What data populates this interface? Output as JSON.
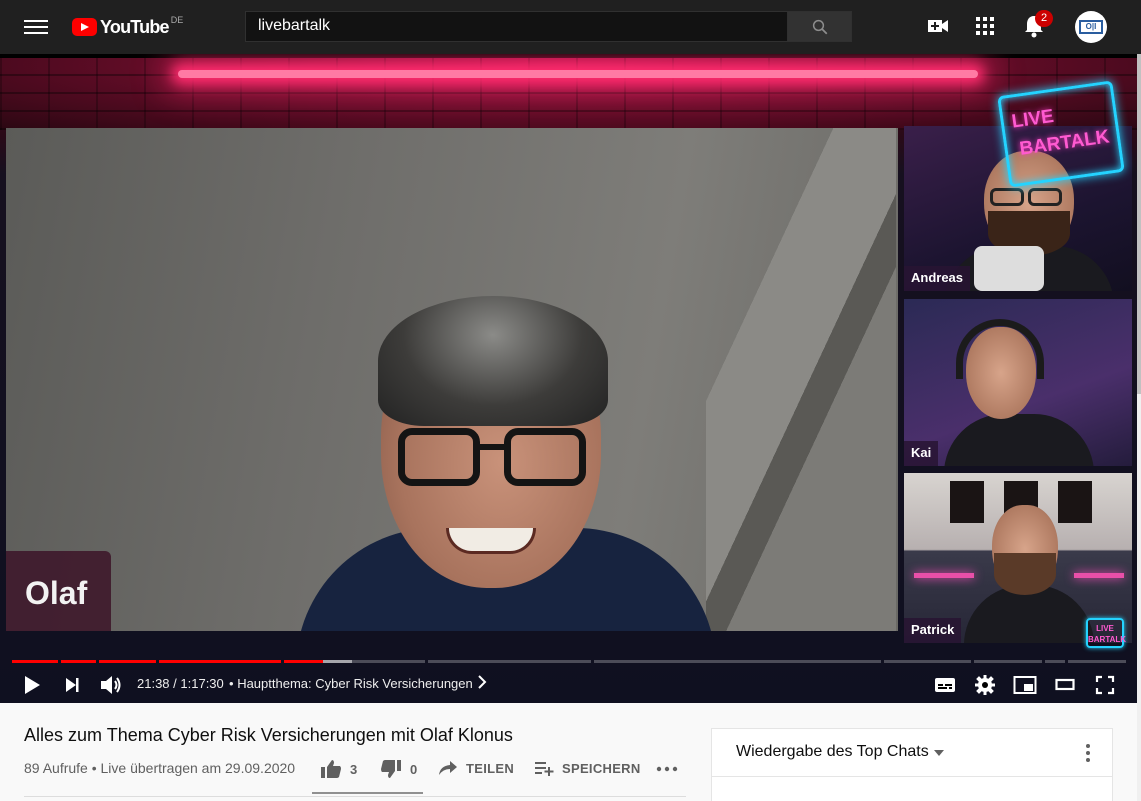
{
  "masthead": {
    "logo_text": "YouTube",
    "country_code": "DE",
    "search_value": "livebartalk",
    "notification_count": "2",
    "avatar_text": "O|I"
  },
  "player": {
    "main_participant": "Olaf",
    "participants": [
      "Andreas",
      "Kai",
      "Patrick"
    ],
    "sign_line1": "LIVE",
    "sign_line2": "BARTALK",
    "mini_sign_line1": "LIVE",
    "mini_sign_line2": "BARTALK",
    "time_current": "21:38",
    "time_separator": " / ",
    "time_total": "1:17:30",
    "chapter_prefix": "•",
    "chapter_title": "Hauptthema: Cyber Risk Versicherungen",
    "progress_played_fraction": 0.279
  },
  "video": {
    "title": "Alles zum Thema Cyber Risk Versicherungen mit Olaf Klonus",
    "meta": "89 Aufrufe • Live übertragen am 29.09.2020",
    "likes": "3",
    "dislikes": "0",
    "share_label": "TEILEN",
    "save_label": "SPEICHERN"
  },
  "chat": {
    "title": "Wiedergabe des Top Chats"
  },
  "colors": {
    "brand_red": "#ff0000",
    "masthead_bg": "#202020",
    "neon_pink": "#ff2c6e",
    "neon_blue": "#24d3ff"
  }
}
